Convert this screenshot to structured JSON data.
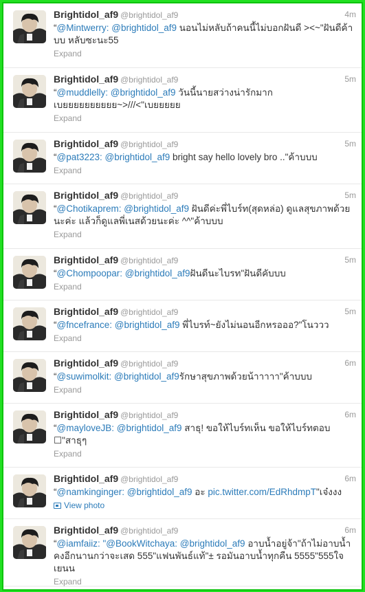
{
  "tweets": [
    {
      "name": "Brightidol_af9",
      "handle": "@brightidol_af9",
      "time": "4m",
      "open": "“",
      "m1": "@Mintwerry:",
      "m2": "@brightidol_af9",
      "body": " นอนไม่หลับถ้าคนนี้ไม่บอกฝันดี ><~\"ฝันดีค้าบบ หลับซะนะ55",
      "action": "Expand"
    },
    {
      "name": "Brightidol_af9",
      "handle": "@brightidol_af9",
      "time": "5m",
      "open": "“",
      "m1": "@muddlelly:",
      "m2": "@brightidol_af9",
      "body": " วันนี้นายสว่างน่ารักมากเบยยยยยยยยยย~>///<\"เบยยยยย",
      "action": "Expand"
    },
    {
      "name": "Brightidol_af9",
      "handle": "@brightidol_af9",
      "time": "5m",
      "open": "“",
      "m1": "@pat3223:",
      "m2": "@brightidol_af9",
      "body": " bright say hello lovely bro ..\"ค้าบบบ",
      "action": "Expand"
    },
    {
      "name": "Brightidol_af9",
      "handle": "@brightidol_af9",
      "time": "5m",
      "open": "“",
      "m1": "@Chotikaprem:",
      "m2": "@brightidol_af9",
      "body": " ฝันดีค่ะพี่ไบร์ท(สุดหล่อ) ดูแลสุขภาพด้วยนะค่ะ แล้วก็ดูแลพี่เนสด้วยนะค่ะ ^^\"ค้าบบบ",
      "action": "Expand"
    },
    {
      "name": "Brightidol_af9",
      "handle": "@brightidol_af9",
      "time": "5m",
      "open": "“",
      "m1": "@Chompoopar:",
      "m2": "@brightidol_af9",
      "body": "ฝันดีนะไบรท\"ฝันดีคับบบ",
      "action": "Expand"
    },
    {
      "name": "Brightidol_af9",
      "handle": "@brightidol_af9",
      "time": "5m",
      "open": "“",
      "m1": "@fncefrance:",
      "m2": "@brightidol_af9",
      "body": " พี่ไบรท์~ยังไม่นอนอีกหรอออ?\"โนววว",
      "action": "Expand"
    },
    {
      "name": "Brightidol_af9",
      "handle": "@brightidol_af9",
      "time": "6m",
      "open": "“",
      "m1": "@suwimolkit:",
      "m2": "@brightidol_af9",
      "body": "รักษาสุขภาพด้วยน้าาาาา\"ค้าบบบ",
      "action": "Expand"
    },
    {
      "name": "Brightidol_af9",
      "handle": "@brightidol_af9",
      "time": "6m",
      "open": "“",
      "m1": "@mayloveJB:",
      "m2": "@brightidol_af9",
      "body": " สาธุ! ขอให้ไบร์ทเห็น ขอให้ไบร์ทตอบ ☐\"สาธุๆ",
      "action": "Expand"
    },
    {
      "name": "Brightidol_af9",
      "handle": "@brightidol_af9",
      "time": "6m",
      "open": "“",
      "m1": "@namkinginger:",
      "m2": "@brightidol_af9",
      "body": " อะ ",
      "link": "pic.twitter.com/EdRhdmpT",
      "tail": "\"เจ๋งงง",
      "action": "View photo"
    },
    {
      "name": "Brightidol_af9",
      "handle": "@brightidol_af9",
      "time": "6m",
      "open": "“",
      "m1": "@iamfaiiz:",
      "m2": "\"@BookWitchaya:",
      "m3": "@brightidol_af9",
      "body": " อาบน้ำอยู่จ้า\"ถ้าไม่อาบน้ำคงอีกนานกว่าจะเสด 555\"แฟนพันธ์แท้\"± รอมันอาบน้ำทุกคืน 5555\"555ใจเยนน",
      "action": "Expand"
    }
  ],
  "icons": {
    "avatar": "avatar-photo-icon",
    "photo": "photo-icon"
  },
  "colors": {
    "link": "#2b7bb9",
    "frame": "#22e022",
    "text": "#333333",
    "meta": "#999999"
  }
}
